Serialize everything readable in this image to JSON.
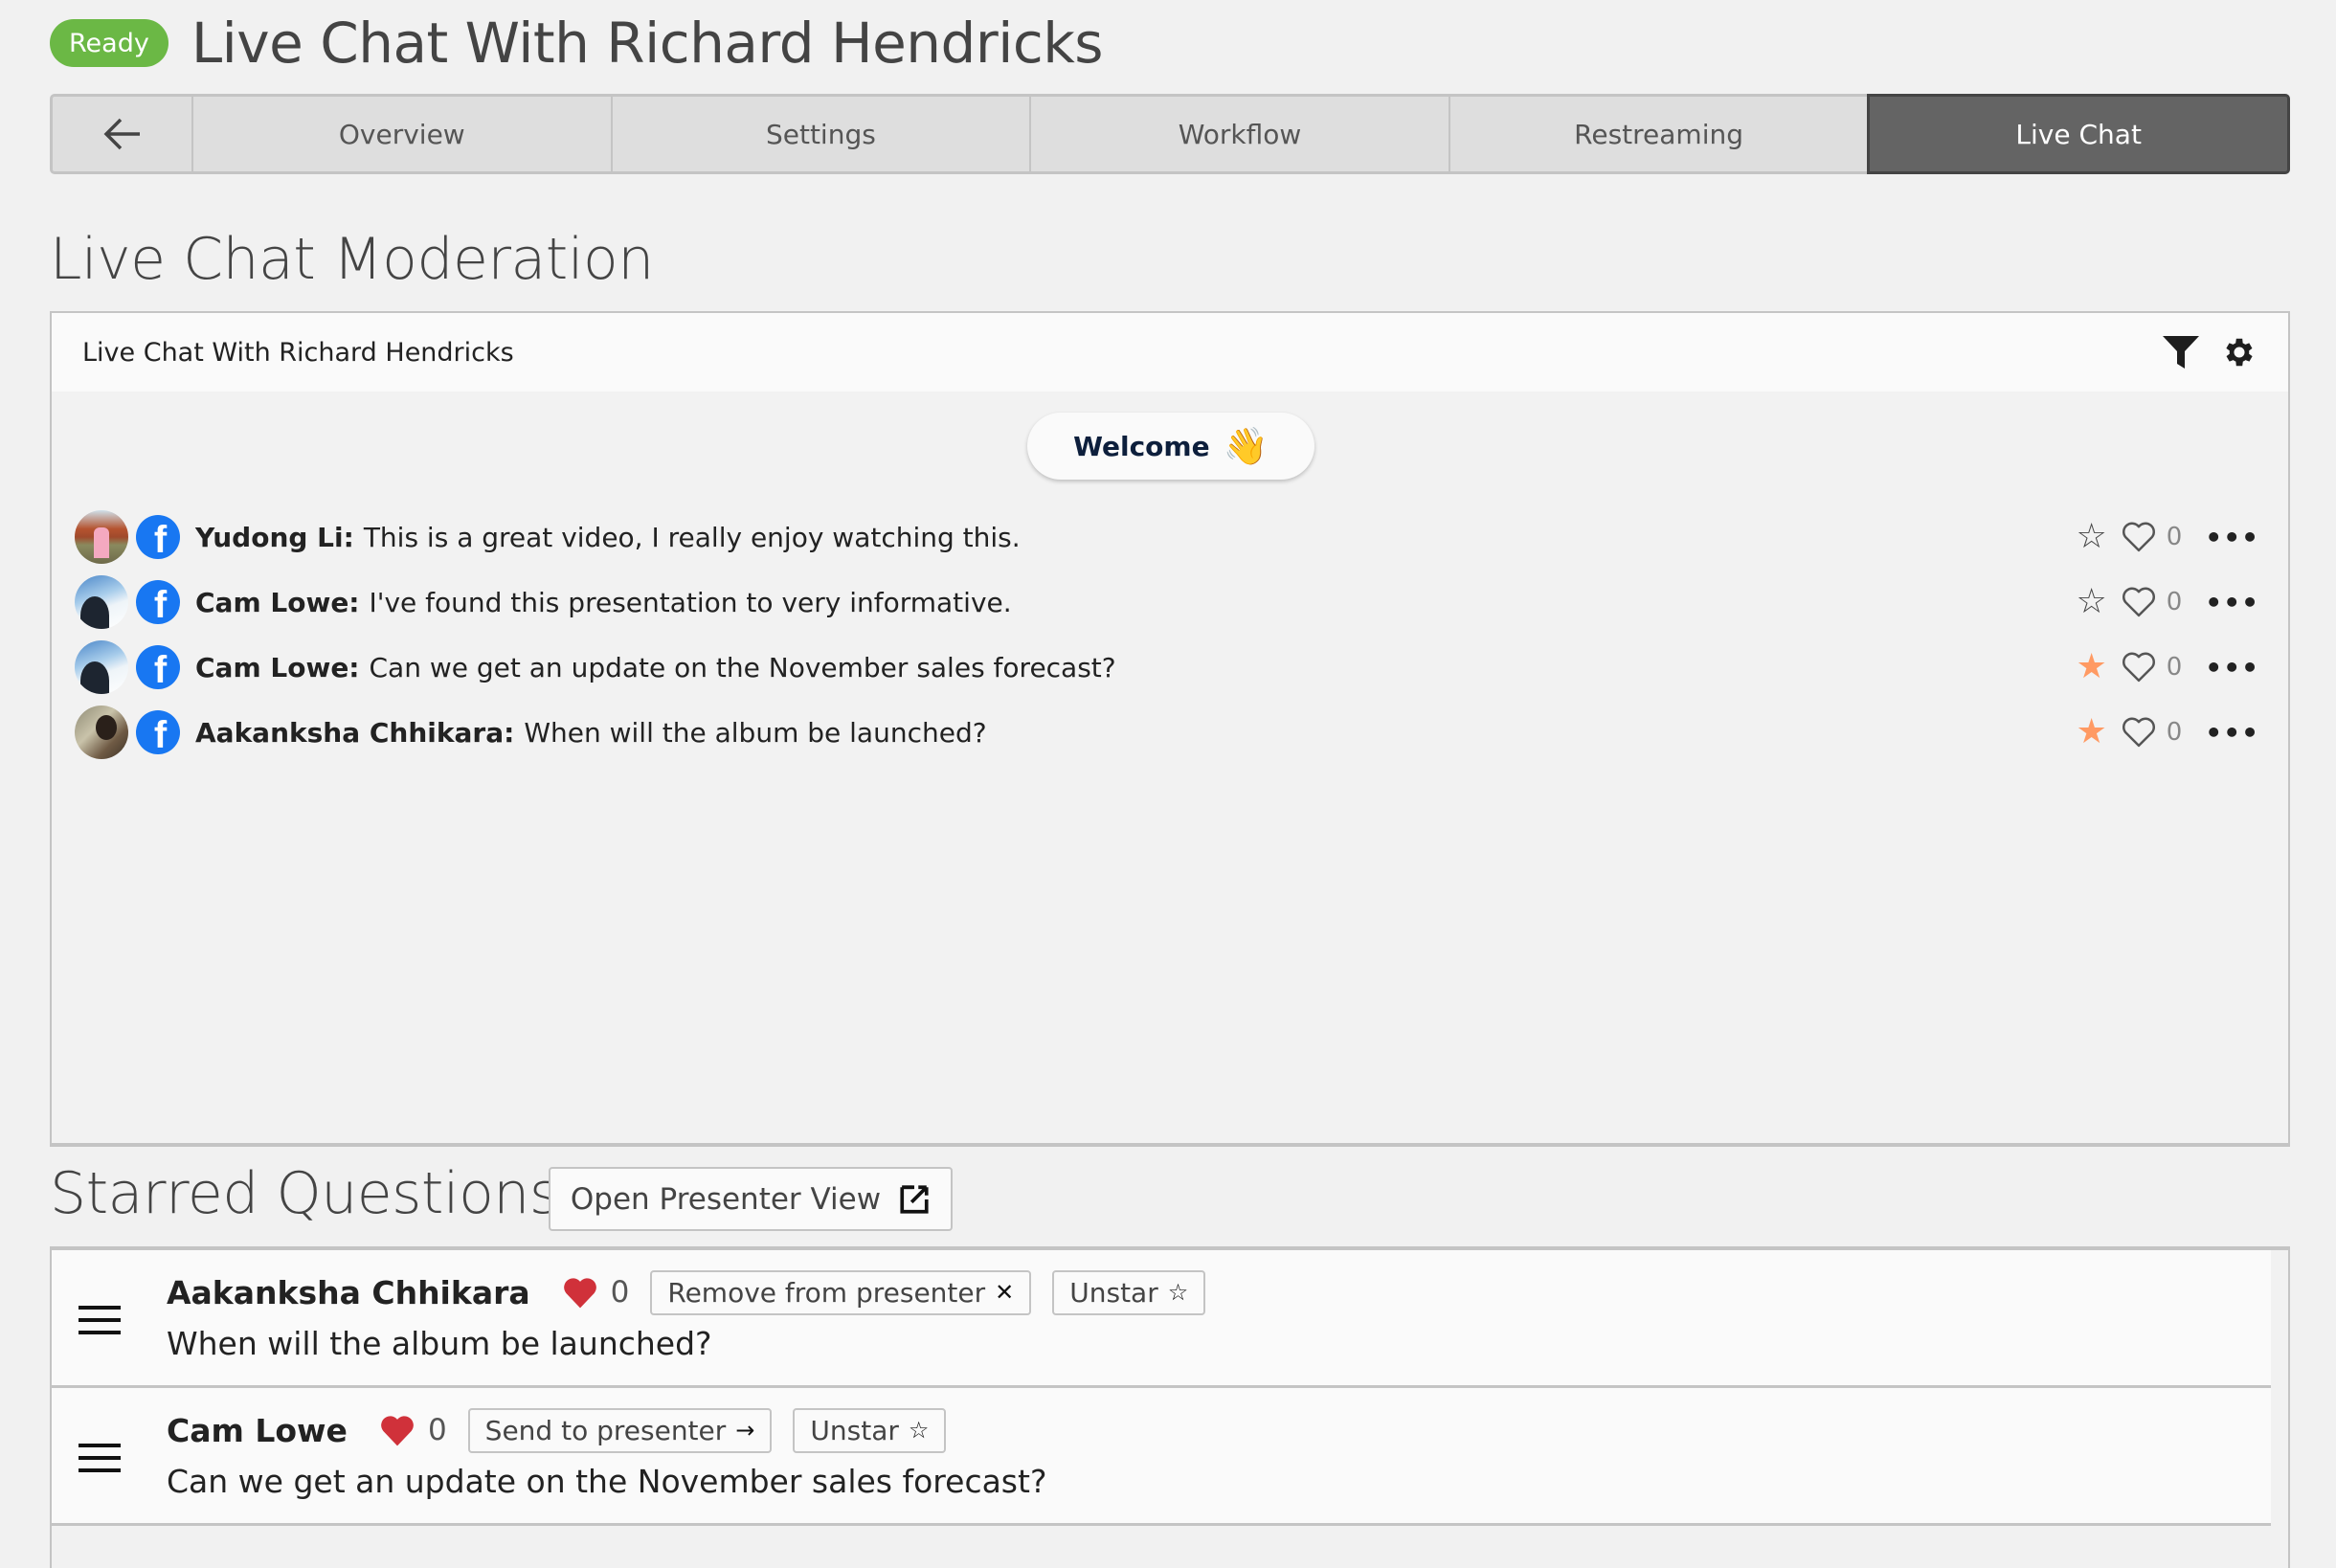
{
  "header": {
    "status_badge": "Ready",
    "title": "Live Chat With Richard Hendricks"
  },
  "tabs": {
    "back_icon": "arrow-left-icon",
    "items": [
      {
        "label": "Overview",
        "active": false
      },
      {
        "label": "Settings",
        "active": false
      },
      {
        "label": "Workflow",
        "active": false
      },
      {
        "label": "Restreaming",
        "active": false
      },
      {
        "label": "Live Chat",
        "active": true
      }
    ]
  },
  "moderation": {
    "heading": "Live Chat Moderation",
    "panel_title": "Live Chat With Richard Hendricks",
    "icons": [
      "filter-icon",
      "gear-icon"
    ],
    "welcome_label": "Welcome",
    "welcome_emoji": "👋",
    "messages": [
      {
        "author": "Yudong Li:",
        "text": "This is a great video, I really enjoy watching this.",
        "source": "facebook",
        "starred": false,
        "likes": "0"
      },
      {
        "author": "Cam Lowe:",
        "text": "I've found this presentation to very informative.",
        "source": "facebook",
        "starred": false,
        "likes": "0"
      },
      {
        "author": "Cam Lowe:",
        "text": "Can we get an update on the November sales forecast?",
        "source": "facebook",
        "starred": true,
        "likes": "0"
      },
      {
        "author": "Aakanksha Chhikara:",
        "text": "When will the album be launched?",
        "source": "facebook",
        "starred": true,
        "likes": "0"
      }
    ]
  },
  "starred": {
    "heading": "Starred Questions",
    "open_presenter_label": "Open Presenter View",
    "items": [
      {
        "author": "Aakanksha Chhikara",
        "likes": "0",
        "presenter_action": "Remove from presenter",
        "presenter_glyph": "✕",
        "unstar_label": "Unstar",
        "text": "When will the album be launched?"
      },
      {
        "author": "Cam Lowe",
        "likes": "0",
        "presenter_action": "Send to presenter",
        "presenter_glyph": "→",
        "unstar_label": "Unstar",
        "text": "Can we get an update on the November sales forecast?"
      }
    ]
  },
  "colors": {
    "ready_green": "#6bb845",
    "active_tab": "#646464",
    "star_on": "#ff9a63",
    "heart_filled": "#d0313a",
    "facebook_blue": "#1877f2"
  }
}
